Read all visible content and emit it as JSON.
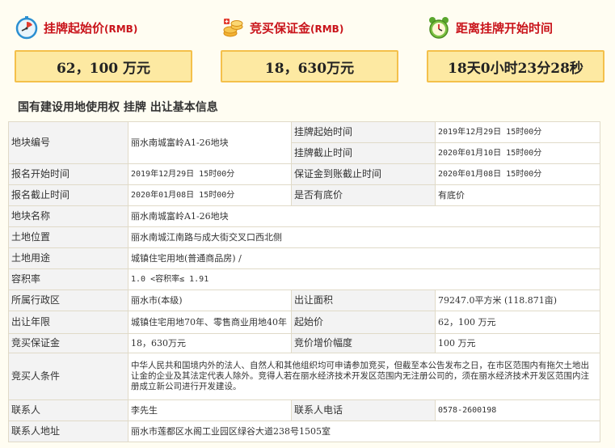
{
  "summary": {
    "start_price": {
      "title": "挂牌起始价",
      "unit": "(RMB)",
      "value": "62，100  万元",
      "icon": "stopwatch-icon"
    },
    "deposit": {
      "title": "竞买保证金",
      "unit": "(RMB)",
      "value": "18，630万元",
      "icon": "gold-coins-icon"
    },
    "countdown": {
      "title": "距离挂牌开始时间",
      "unit": "",
      "value": "18天0小时23分28秒",
      "icon": "alarm-clock-icon"
    }
  },
  "section_title": "国有建设用地使用权 挂牌 出让基本信息",
  "table": {
    "plot_no_label": "地块编号",
    "plot_no": "丽水南城富岭A1-26地块",
    "list_start_label": "挂牌起始时间",
    "list_start": "2019年12月29日 15时00分",
    "list_end_label": "挂牌截止时间",
    "list_end": "2020年01月10日 15时00分",
    "reg_start_label": "报名开始时间",
    "reg_start": "2019年12月29日 15时00分",
    "deposit_deadline_label": "保证金到账截止时间",
    "deposit_deadline": "2020年01月08日 15时00分",
    "reg_end_label": "报名截止时间",
    "reg_end": "2020年01月08日 15时00分",
    "reserve_label": "是否有底价",
    "reserve": "有底价",
    "plot_name_label": "地块名称",
    "plot_name": "丽水南城富岭A1-26地块",
    "location_label": "土地位置",
    "location": "丽水南城江南路与成大街交叉口西北侧",
    "usage_label": "土地用途",
    "usage": "城镇住宅用地(普通商品房) /",
    "far_label": "容积率",
    "far": "1.0 <容积率≤ 1.91",
    "district_label": "所属行政区",
    "district": "丽水市(本级)",
    "area_label": "出让面积",
    "area": "79247.0平方米 (118.871亩)",
    "term_label": "出让年限",
    "term": "城镇住宅用地70年、零售商业用地40年",
    "start_price_label": "起始价",
    "start_price": "62，100  万元",
    "bid_deposit_label": "竞买保证金",
    "bid_deposit": "18，630万元",
    "increment_label": "竞价增价幅度",
    "increment": "100  万元",
    "bidder_cond_label": "竞买人条件",
    "bidder_cond": "中华人民共和国境内外的法人、自然人和其他组织均可申请参加竞买，但截至本公告发布之日，在市区范围内有拖欠土地出让金的企业及其法定代表人除外。竞得人若在丽水经济技术开发区范围内无注册公司的，须在丽水经济技术开发区范围内注册成立新公司进行开发建设。",
    "contact_label": "联系人",
    "contact": "李先生",
    "phone_label": "联系人电话",
    "phone": "0578-2600198",
    "address_label": "联系人地址",
    "address": "丽水市莲都区水阁工业园区绿谷大道238号1505室"
  },
  "colors": {
    "accent_red": "#c9141b",
    "box_fill": "#fde9a2",
    "box_border": "#f4c04b",
    "label_bg": "#f3f3f3"
  }
}
